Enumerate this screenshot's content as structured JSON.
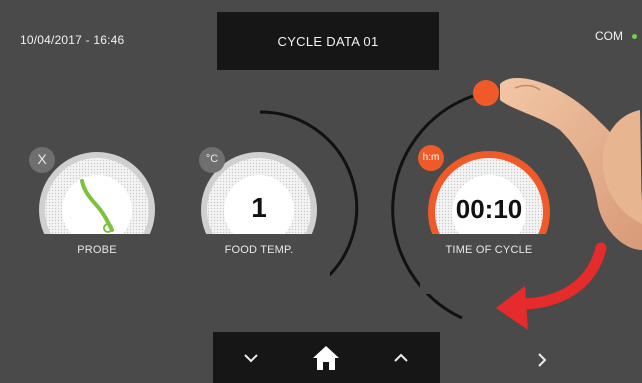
{
  "header": {
    "datetime": "10/04/2017 - 16:46",
    "title": "CYCLE DATA 01",
    "status_label": "COM"
  },
  "gauges": [
    {
      "label": "PROBE",
      "badge": "X",
      "icon": "probe-icon"
    },
    {
      "label": "FOOD TEMP.",
      "badge": "°C",
      "value": "1"
    },
    {
      "label": "TIME OF CYCLE",
      "badge": "h:m",
      "value": "00:10"
    }
  ],
  "navigation": {
    "down": "chevron-down-icon",
    "home": "home-icon",
    "up": "chevron-up-icon",
    "next": "chevron-right-icon"
  },
  "colors": {
    "screen_bg": "#4a4a4a",
    "bar_bg": "#161616",
    "accent": "#f05a28",
    "probe_green": "#7cc23a",
    "status_dot": "#6fd24a"
  }
}
